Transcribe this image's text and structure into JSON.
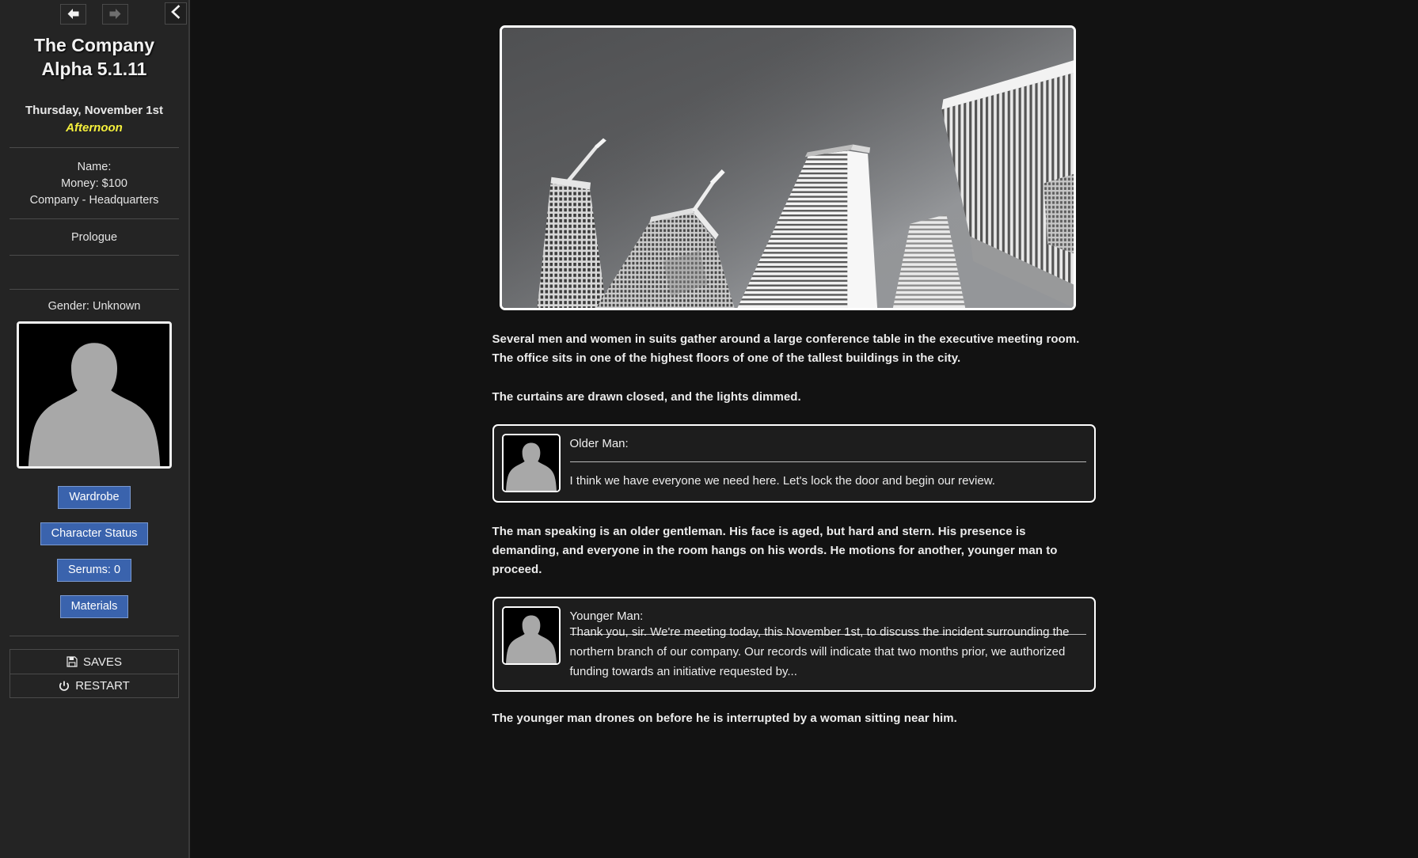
{
  "sidebar": {
    "nav": {
      "back_icon": "arrow-left-icon",
      "forward_icon": "arrow-right-icon",
      "collapse_icon": "chevron-left-icon"
    },
    "title_line1": "The Company",
    "title_line2": "Alpha 5.1.11",
    "date": "Thursday, November 1st",
    "time_of_day": "Afternoon",
    "stats": [
      "Name:",
      "Money: $100",
      "Company - Headquarters"
    ],
    "chapter": "Prologue",
    "gender": "Gender: Unknown",
    "portrait_alt": "silhouette-portrait",
    "buttons": [
      {
        "label": "Wardrobe",
        "name": "wardrobe-button"
      },
      {
        "label": "Character Status",
        "name": "character-status-button"
      },
      {
        "label": "Serums: 0",
        "name": "serums-button"
      },
      {
        "label": "Materials",
        "name": "materials-button"
      }
    ],
    "bottom_menu": [
      {
        "label": "SAVES",
        "icon": "floppy-disk-icon"
      },
      {
        "label": "RESTART",
        "icon": "power-icon"
      }
    ],
    "colors": {
      "panel_bg": "#242424",
      "button_blue": "#3a63ad",
      "button_border": "#7b9ad0",
      "time_yellow": "#f5f03c",
      "text": "#ececec"
    }
  },
  "main": {
    "scene_image_alt": "skyscrapers-looking-up-black-and-white",
    "narration_1": "Several men and women in suits gather around a large conference table in the executive meeting room. The office sits in one of the highest floors of one of the tallest buildings in the city.",
    "narration_2": "The curtains are drawn closed, and the lights dimmed.",
    "dialogue_1": {
      "speaker": "Older Man:",
      "text": "I think we have everyone we need here. Let's lock the door and begin our review.",
      "avatar_alt": "older-man-silhouette-avatar"
    },
    "narration_3": "The man speaking is an older gentleman. His face is aged, but hard and stern. His presence is demanding, and everyone in the room hangs on his words. He motions for another, younger man to proceed.",
    "dialogue_2": {
      "speaker": "Younger Man:",
      "text": "Thank you, sir. We're meeting today, this November 1st, to discuss the incident surrounding the northern branch of our company. Our records will indicate that two months prior, we authorized funding towards an initiative requested by...",
      "avatar_alt": "younger-man-silhouette-avatar"
    },
    "narration_4": "The younger man drones on before he is interrupted by a woman sitting near him."
  }
}
